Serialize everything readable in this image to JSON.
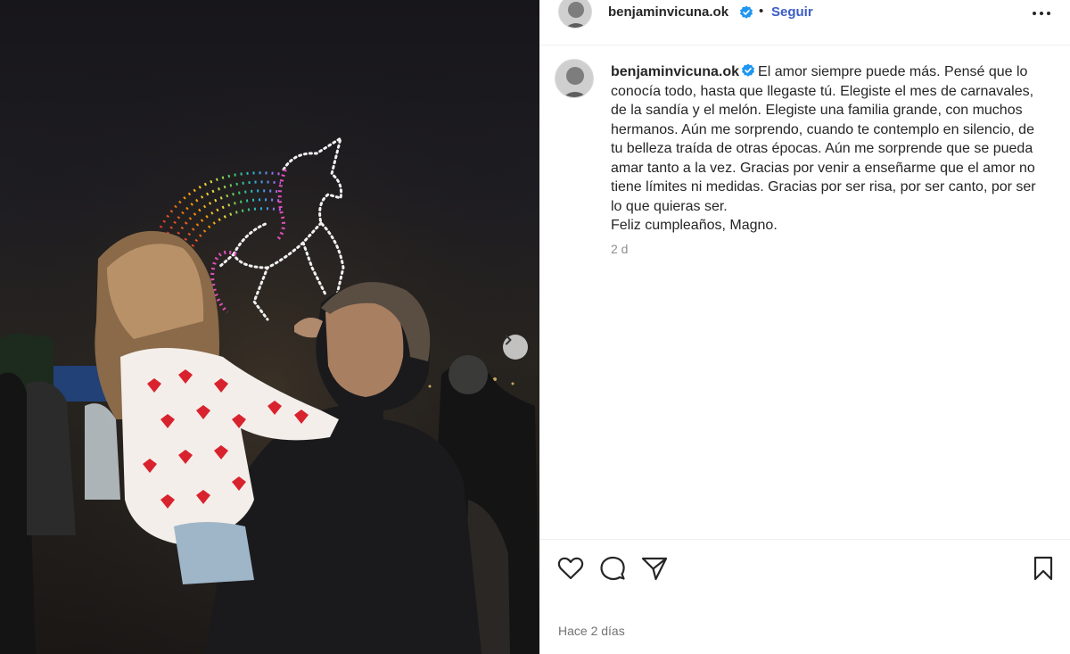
{
  "post": {
    "username": "benjaminvicuna.ok",
    "separator": "•",
    "follow_label": "Seguir",
    "caption_lines": [
      "El amor siempre puede más. Pensé que lo conocía todo, hasta que llegaste tú. Elegiste el mes de carnavales, de la sandía y el melón. Elegiste una familia grande, con muchos hermanos. Aún me sorprendo, cuando te contemplo en silencio, de tu belleza traída de otras épocas. Aún me sorprende que se pueda amar tanto a la vez. Gracias por venir a enseñarme que el amor no tiene límites ni medidas. Gracias por ser risa, por ser canto, por ser lo que quieras ser.",
      "Feliz cumpleaños, Magno."
    ],
    "time_short": "2 d",
    "time_long": "Hace 2 días"
  },
  "icons": {
    "verified": "verified-badge-icon",
    "more": "more-options-icon",
    "next": "chevron-right-icon",
    "like": "heart-icon",
    "comment": "comment-icon",
    "share": "share-paper-plane-icon",
    "save": "bookmark-icon"
  },
  "colors": {
    "follow": "#3b5cc6",
    "verified": "#1f96f0",
    "muted": "#8e8e8e"
  }
}
